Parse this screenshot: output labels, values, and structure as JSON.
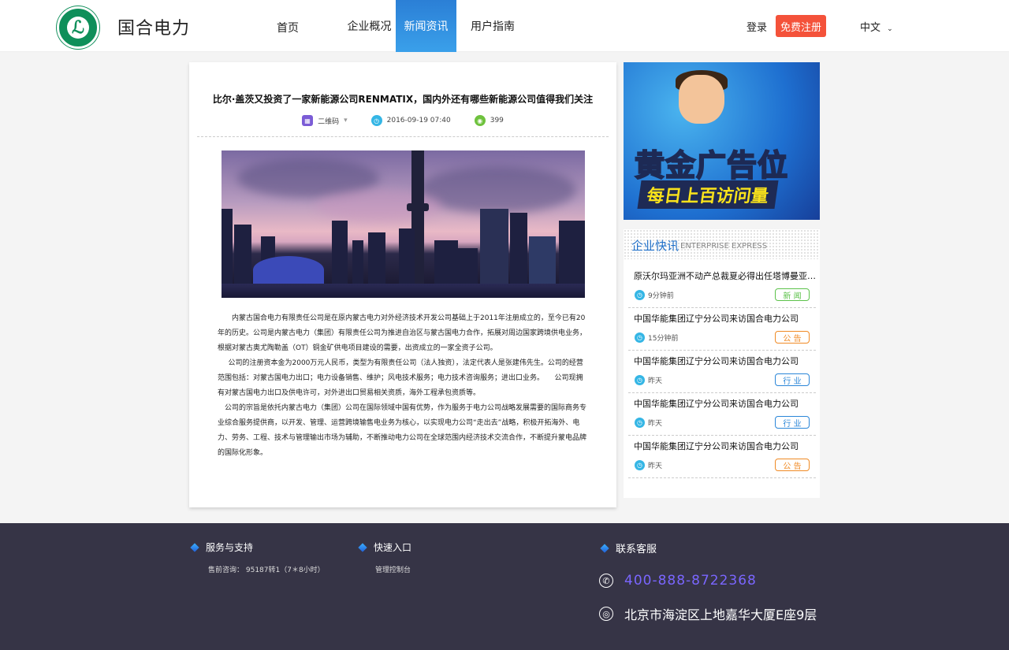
{
  "header": {
    "brand": "国合电力",
    "nav": [
      {
        "label": "首页"
      },
      {
        "label": "企业概况"
      },
      {
        "label": "新闻资讯"
      },
      {
        "label": "用户指南"
      }
    ],
    "login": "登录",
    "register": "免费注册",
    "language": "中文",
    "accent": "#f4523a"
  },
  "article": {
    "title": "比尔·盖茨又投资了一家新能源公司RENMATIX，国内外还有哪些新能源公司值得我们关注",
    "qr_label": "二维码",
    "date": "2016-09-19 07:40",
    "views": "399",
    "paragraphs": [
      "内蒙古国合电力有限责任公司是在原内蒙古电力对外经济技术开发公司基础上于2011年注册成立的，至今已有20年的历史。公司是内蒙古电力（集团）有限责任公司为推进自治区与蒙古国电力合作，拓展对周边国家跨境供电业务，根据对蒙古奥尤陶勒盖（OT）铜金矿供电项目建设的需要，出资成立的一家全资子公司。",
      "公司的注册资本金为2000万元人民币，类型为有限责任公司（法人独资），法定代表人是张建伟先生。公司的经营范围包括：对蒙古国电力出口；电力设备销售、维护；风电技术服务；电力技术咨询服务；进出口业务。　　公司现拥有对蒙古国电力出口及供电许可，对外进出口贸易相关资质，海外工程承包资质等。",
      "公司的宗旨是依托内蒙古电力（集团）公司在国际领域中国有优势，作为服务于电力公司战略发展需要的国际商务专业综合服务提供商，以开发、管理、运营跨境输售电业务为核心，以实现电力公司“走出去”战略，积极开拓海外、电力、劳务、工程、技术与管理输出市场为辅助，不断推动电力公司在全球范围内经济技术交流合作，不断提升蒙电品牌的国际化形象。"
    ]
  },
  "ad": {
    "title": "黄金广告位",
    "subtitle": "每日上百访问量"
  },
  "news": {
    "title": "企业快讯",
    "subtitle": "ENTERPRISE EXPRESS",
    "items": [
      {
        "title": "原沃尔玛亚洲不动产总裁夏必得出任塔博曼亚洲...",
        "time": "9分钟前",
        "tag": "新 闻",
        "tag_color": "#5cc24a"
      },
      {
        "title": "中国华能集团辽宁分公司来访国合电力公司",
        "time": "15分钟前",
        "tag": "公 告",
        "tag_color": "#f08a24"
      },
      {
        "title": "中国华能集团辽宁分公司来访国合电力公司",
        "time": "昨天",
        "tag": "行 业",
        "tag_color": "#2a86d8"
      },
      {
        "title": "中国华能集团辽宁分公司来访国合电力公司",
        "time": "昨天",
        "tag": "行 业",
        "tag_color": "#2a86d8"
      },
      {
        "title": "中国华能集团辽宁分公司来访国合电力公司",
        "time": "昨天",
        "tag": "公 告",
        "tag_color": "#f08a24"
      }
    ]
  },
  "footer": {
    "support_title": "服务与支持",
    "support_text": "售前咨询： 95187转1（7＊8小时）",
    "quick_title": "快速入口",
    "quick_link": "管理控制台",
    "contact_title": "联系客服",
    "phone": "400-888-8722368",
    "address": "北京市海淀区上地嘉华大厦E座9层"
  }
}
